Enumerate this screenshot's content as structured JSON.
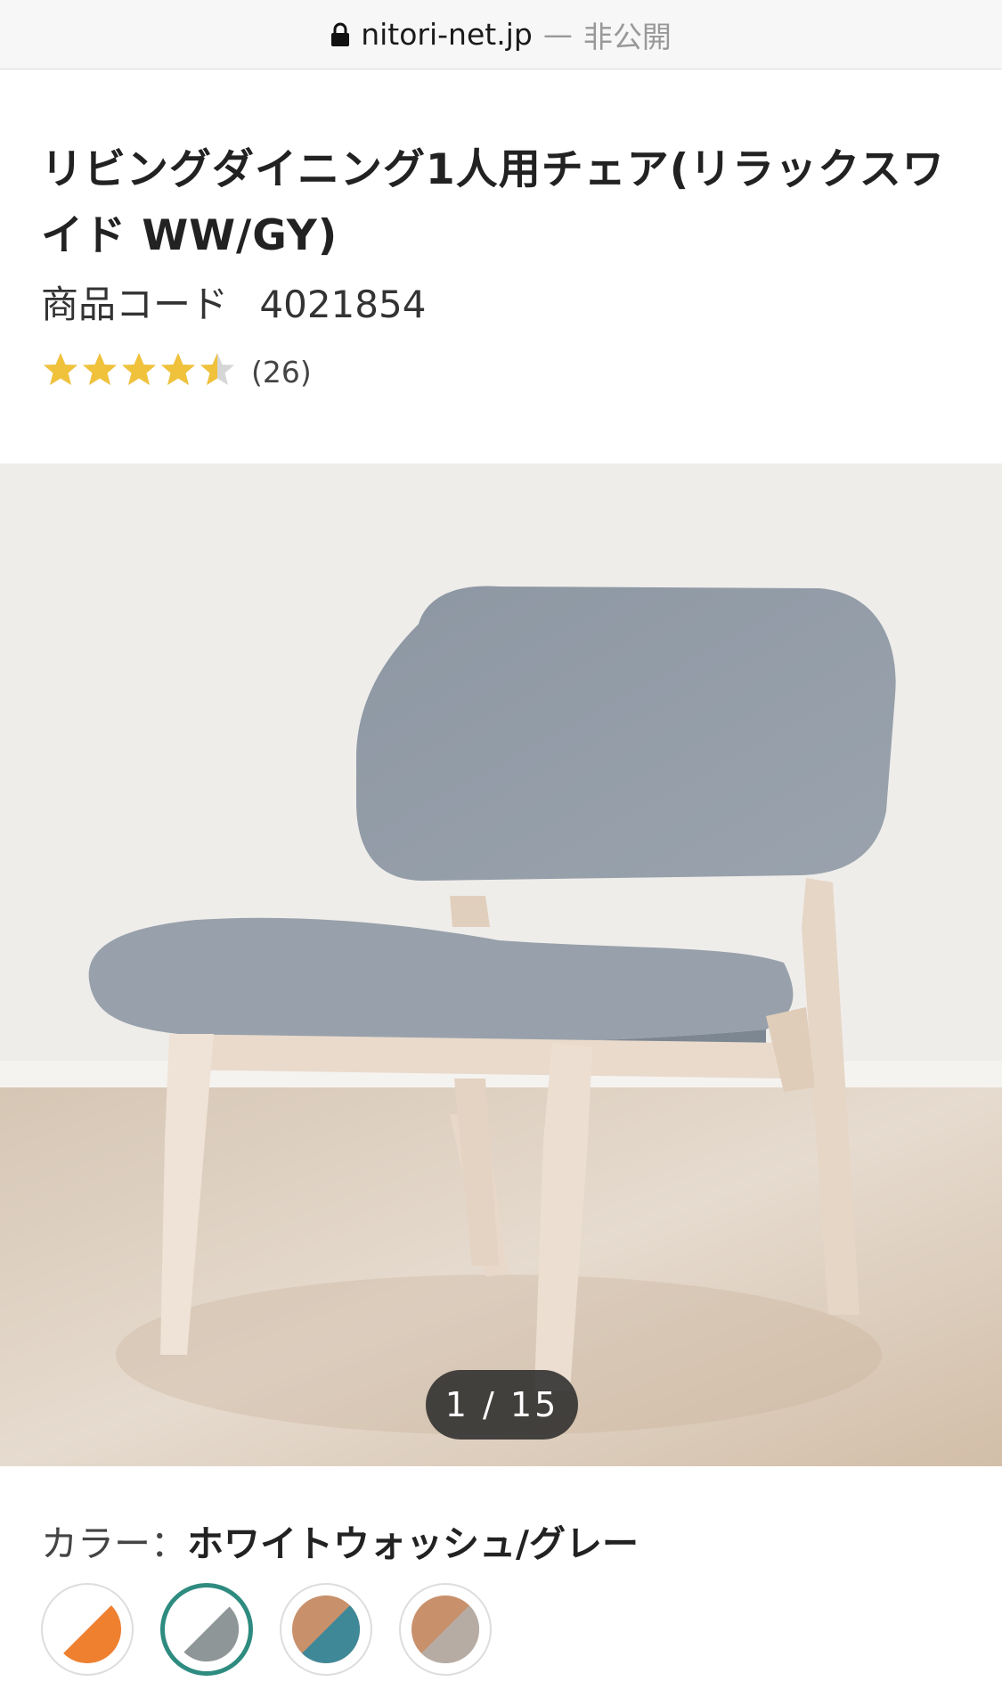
{
  "browser": {
    "domain": "nitori-net.jp",
    "separator": "—",
    "status": "非公開"
  },
  "product": {
    "title": "リビングダイニング1人用チェア(リラックスワイド WW/GY)",
    "code_label": "商品コード",
    "code": "4021854",
    "rating": 4.5,
    "review_count": "(26)"
  },
  "gallery": {
    "counter": "1 / 15",
    "current": 1,
    "total": 15
  },
  "color": {
    "label": "カラー：",
    "selected": "ホワイトウォッシュ/グレー",
    "swatches": [
      {
        "name": "orange",
        "colors": [
          "#ffffff",
          "#ee8030"
        ]
      },
      {
        "name": "white-wash-gray",
        "colors": [
          "#ffffff",
          "#8f9697"
        ],
        "selected": true
      },
      {
        "name": "brown-teal",
        "colors": [
          "#c8916c",
          "#3f8898"
        ]
      },
      {
        "name": "brown-beige",
        "colors": [
          "#c8916c",
          "#b6aca3"
        ]
      }
    ]
  },
  "colors": {
    "star": "#f0c23b",
    "star_empty": "#d6d6d6",
    "selected_ring": "#2e8b80"
  }
}
